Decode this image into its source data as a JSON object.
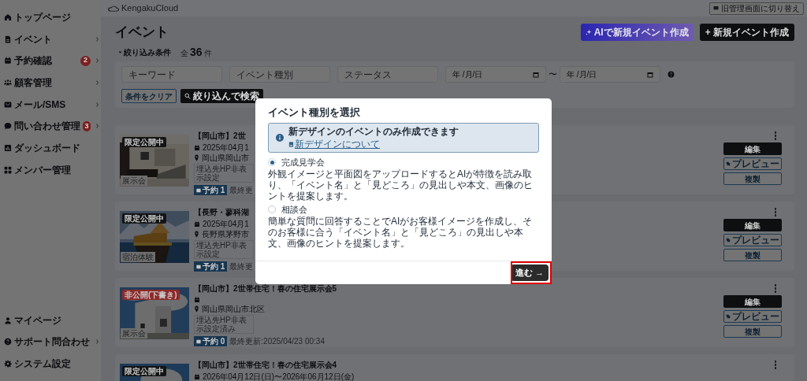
{
  "header": {
    "logo": "KengakuCloud",
    "switch_button": "旧管理画面に切り替え"
  },
  "sidebar": {
    "items": [
      {
        "label": "トップページ",
        "chevron": false
      },
      {
        "label": "イベント",
        "chevron": true
      },
      {
        "label": "予約確認",
        "chevron": true,
        "badge": "2"
      },
      {
        "label": "顧客管理",
        "chevron": true
      },
      {
        "label": "メール/SMS",
        "chevron": true
      },
      {
        "label": "問い合わせ管理",
        "chevron": true,
        "badge": "3"
      },
      {
        "label": "ダッシュボード",
        "chevron": false
      },
      {
        "label": "メンバー管理",
        "chevron": false
      }
    ],
    "bottom_items": [
      {
        "label": "マイページ",
        "chevron": false
      },
      {
        "label": "サポート問合わせ",
        "chevron": true
      },
      {
        "label": "システム設定",
        "chevron": false
      }
    ]
  },
  "page": {
    "title": "イベント",
    "ai_button": "AIで新規イベント作成",
    "new_button": "+ 新規イベント作成"
  },
  "filter": {
    "toggle": "絞り込み条件",
    "total_prefix": "全",
    "total": "36",
    "total_suffix": "件",
    "fields": [
      {
        "kind": "text",
        "placeholder": "キーワード"
      },
      {
        "kind": "text",
        "placeholder": "イベント種別"
      },
      {
        "kind": "text",
        "placeholder": "ステータス"
      },
      {
        "kind": "date",
        "value": "年 /月/日"
      },
      {
        "kind": "date",
        "value": "年 /月/日"
      }
    ],
    "range_separator": "〜",
    "clear_button": "条件をクリア",
    "search_button": "絞り込んで検索"
  },
  "events": [
    {
      "status": {
        "label": "限定公開中",
        "color": "#131416"
      },
      "category": "展示会",
      "title": "【岡山市】2世",
      "date": "2025年04月1",
      "location": "岡山県岡山市",
      "tag": "埋込先HP非表示設定",
      "reservations": "予約 1",
      "updated": "最終更",
      "buttons": [
        "編集",
        "プレビュー",
        "複製"
      ]
    },
    {
      "status": {
        "label": "限定公開中",
        "color": "#131416"
      },
      "category": "宿泊体験",
      "title": "【長野・蓼科湖",
      "date": "2025年04月1",
      "location": "長野県茅野市",
      "tag": "埋込先HP非表示設定",
      "reservations": "予約 1",
      "updated": "最終更",
      "buttons": [
        "編集",
        "プレビュー",
        "複製"
      ]
    },
    {
      "status": {
        "label": "非公開(下書き)",
        "color": "#8e2a2a"
      },
      "category": "展示会",
      "title": "【岡山市】2世帯住宅！春の住宅展示会5",
      "location": "岡山県岡山市北区",
      "tag": "埋込先HP非表示設定済み",
      "reservations": "予約 0",
      "updated": "最終更新:2025/04/23 00:34",
      "buttons": [
        "編集",
        "プレビュー",
        "複製"
      ]
    },
    {
      "status": {
        "label": "限定公開中",
        "color": "#131416"
      },
      "title": "【岡山市】2世帯住宅！春の住宅展示会4",
      "date": "2026年04月12日(日)〜2026年06月12日(金)"
    }
  ],
  "modal": {
    "title": "イベント種別を選択",
    "notice": {
      "text": "新デザインのイベントのみ作成できます",
      "link": "新デザインについて"
    },
    "options": [
      {
        "label": "完成見学会",
        "selected": true,
        "description": "外観イメージと平面図をアップロードするとAIが特徴を読み取り、「イベント名」と「見どころ」の見出しや本文、画像のヒントを提案します。"
      },
      {
        "label": "相談会",
        "selected": false,
        "description": "簡単な質問に回答することでAIがお客様イメージを作成し、そのお客様に合う「イベント名」と「見どころ」の見出しや本文、画像のヒントを提案します。"
      }
    ],
    "next_button": "進む →",
    "highlighted": true
  }
}
